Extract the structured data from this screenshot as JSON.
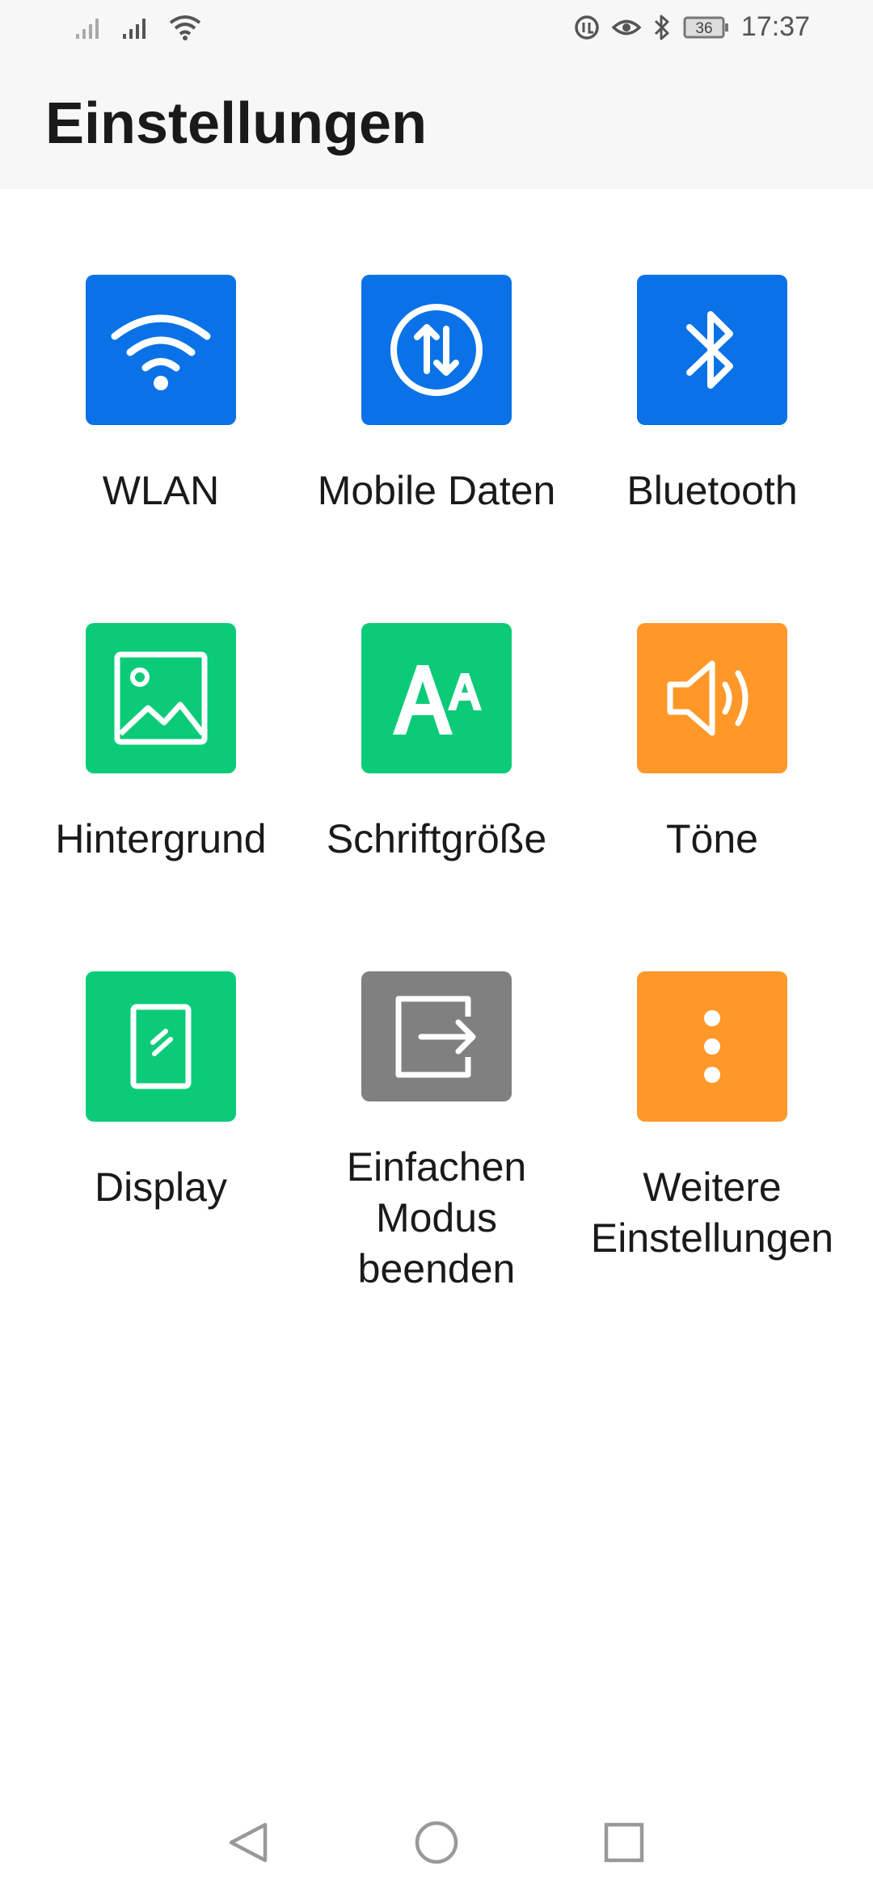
{
  "status_bar": {
    "time": "17:37",
    "battery": "36",
    "icons": [
      "signal-icon",
      "signal-icon",
      "wifi-icon",
      "data-saver-icon",
      "eye-comfort-icon",
      "bluetooth-icon",
      "battery-icon"
    ]
  },
  "header": {
    "title": "Einstellungen"
  },
  "tiles": [
    {
      "label": "WLAN",
      "icon": "wifi-icon",
      "color": "#0a72e6"
    },
    {
      "label": "Mobile Daten",
      "icon": "mobile-data-icon",
      "color": "#0a72e6"
    },
    {
      "label": "Bluetooth",
      "icon": "bluetooth-icon",
      "color": "#0a72e6"
    },
    {
      "label": "Hintergrund",
      "icon": "wallpaper-icon",
      "color": "#0bcb78"
    },
    {
      "label": "Schriftgröße",
      "icon": "font-size-icon",
      "color": "#0bcb78"
    },
    {
      "label": "Töne",
      "icon": "sound-icon",
      "color": "#ff9829"
    },
    {
      "label": "Display",
      "icon": "display-icon",
      "color": "#0bcb78"
    },
    {
      "label": "Einfachen\nModus\nbeenden",
      "icon": "exit-icon",
      "color": "#808080"
    },
    {
      "label": "Weitere\nEinstellungen",
      "icon": "more-icon",
      "color": "#ff9829"
    }
  ],
  "nav_bar": {
    "icons": [
      "back-icon",
      "home-icon",
      "recents-icon"
    ]
  }
}
